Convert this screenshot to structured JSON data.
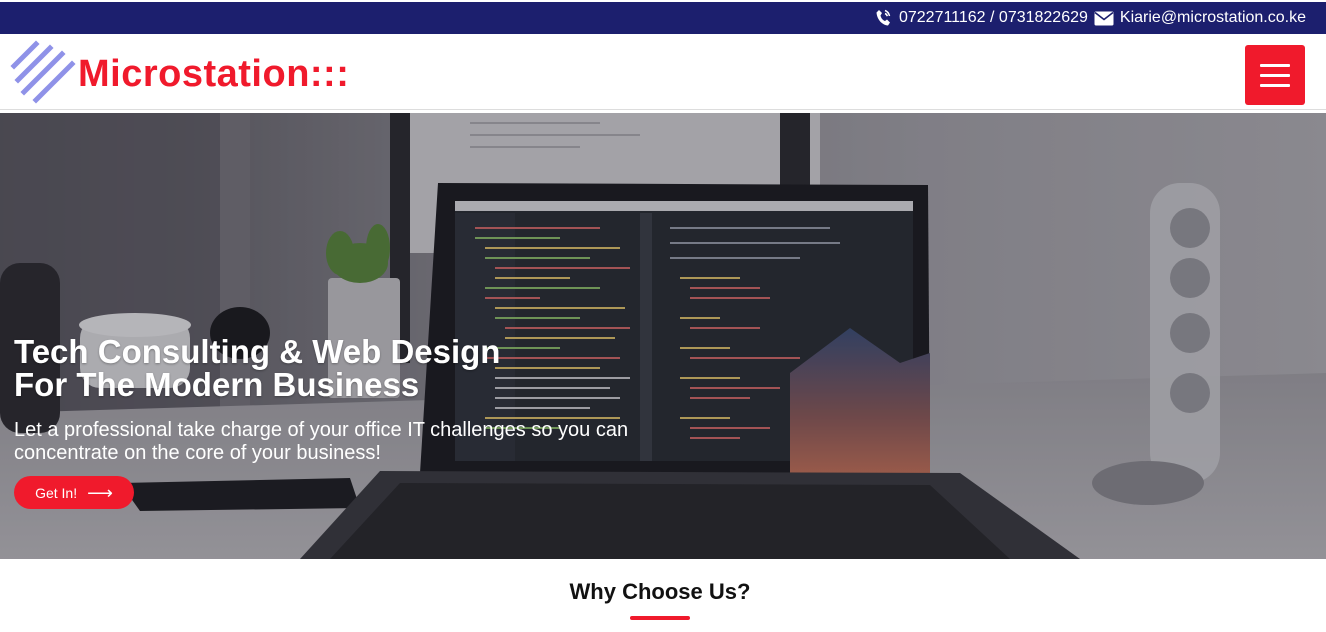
{
  "topbar": {
    "phone_icon": "phone-volume-icon",
    "phones": "0722711162 / 0731822629",
    "email_icon": "envelope-icon",
    "email": "Kiarie@microstation.co.ke"
  },
  "header": {
    "logo_icon": "diagonal-stripes-logo",
    "brand_name": "Microstation:::",
    "menu_icon": "hamburger-menu-icon"
  },
  "hero": {
    "title_line1": "Tech Consulting & Web Design",
    "title_line2": "For The Modern Business",
    "subtitle": "Let a professional take charge of your office IT challenges so you can concentrate on the core of your business!",
    "cta_label": "Get In!",
    "cta_icon": "long-arrow-right-icon"
  },
  "section": {
    "title": "Why Choose Us?"
  },
  "colors": {
    "topbar_bg": "#1c1f6e",
    "accent": "#f01a2c",
    "logo_stripes": "#8f92e8"
  }
}
